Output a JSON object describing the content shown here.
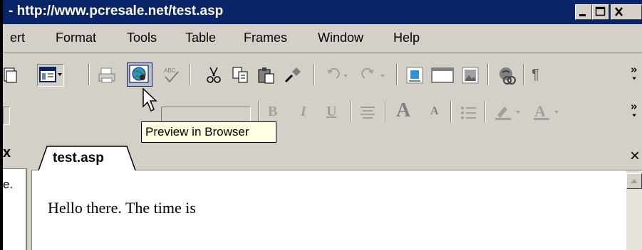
{
  "window": {
    "title": "- http://www.pcresale.net/test.asp",
    "controls": [
      "minimize",
      "maximize",
      "close"
    ]
  },
  "menu": {
    "items": [
      {
        "label": "ert"
      },
      {
        "label": "Format"
      },
      {
        "label": "Tools"
      },
      {
        "label": "Table"
      },
      {
        "label": "Frames"
      },
      {
        "label": "Window"
      },
      {
        "label": "Help"
      }
    ]
  },
  "toolbar": {
    "icons": [
      "partial-icon",
      "view-icon",
      "print-icon",
      "preview-in-browser-icon",
      "spelling-icon",
      "cut-icon",
      "copy-icon",
      "paste-icon",
      "format-painter-icon",
      "undo-icon",
      "redo-icon",
      "insert-component-icon",
      "insert-table-icon",
      "insert-picture-icon",
      "hyperlink-icon",
      "paragraph-marks-icon",
      "toolbar-overflow-icon"
    ],
    "format_icons": [
      "bold-icon",
      "italic-icon",
      "underline-icon",
      "align-center-icon",
      "increase-font-icon",
      "decrease-font-icon",
      "bullets-icon",
      "highlight-icon",
      "font-color-icon",
      "toolbar-overflow-icon"
    ],
    "bold_glyph": "B",
    "italic_glyph": "I",
    "underline_glyph": "U",
    "paragraph_glyph": "¶",
    "font_inc_glyph": "A",
    "font_dec_glyph": "A"
  },
  "tooltip": {
    "text": "Preview in Browser"
  },
  "left_pane": {
    "close_glyph": "x",
    "text": "e."
  },
  "tabs": {
    "active_label": "test.asp",
    "close_glyph": "×"
  },
  "editor": {
    "content": "Hello there. The time is"
  },
  "colors": {
    "titlebar": "#0a246a",
    "chrome": "#d4d0c8",
    "tooltip_bg": "#ffffe1",
    "editor_bg": "#ffffff"
  }
}
